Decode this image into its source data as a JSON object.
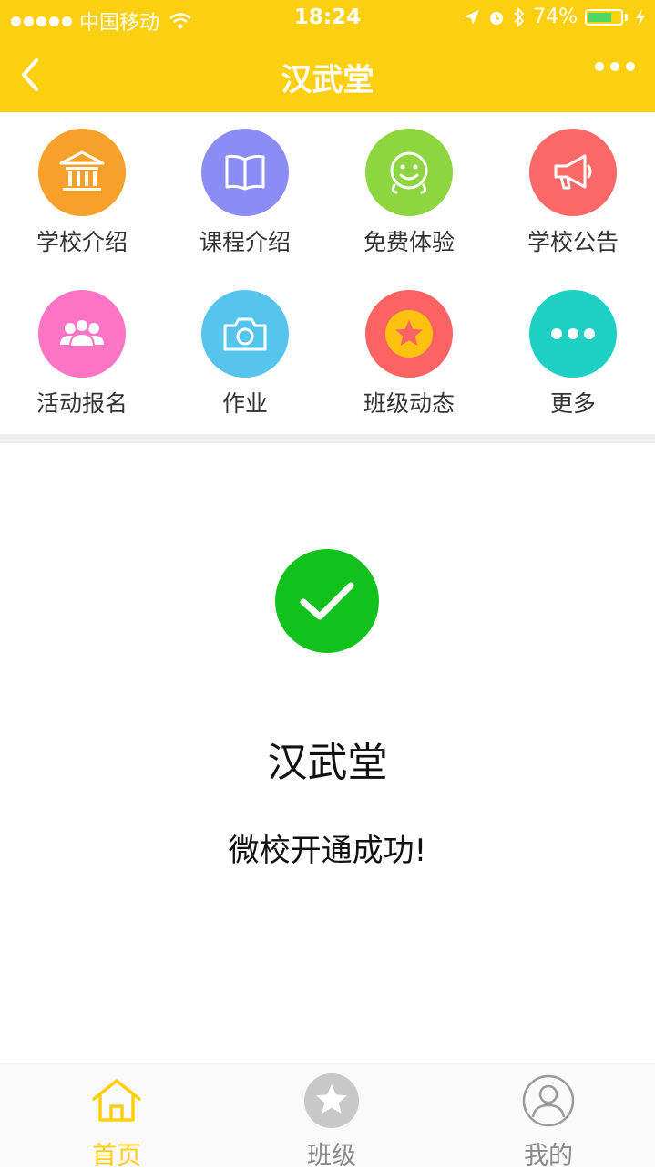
{
  "status_bar": {
    "carrier": "中国移动",
    "time": "18:24",
    "battery": "74%",
    "battery_level": 0.74
  },
  "nav": {
    "title": "汉武堂"
  },
  "grid": [
    {
      "label": "学校介绍",
      "icon": "school-building-icon",
      "color": "#f7a02c"
    },
    {
      "label": "课程介绍",
      "icon": "book-icon",
      "color": "#8c8cf5"
    },
    {
      "label": "免费体验",
      "icon": "smile-face-icon",
      "color": "#8ed640"
    },
    {
      "label": "学校公告",
      "icon": "megaphone-icon",
      "color": "#fb6868"
    },
    {
      "label": "活动报名",
      "icon": "group-people-icon",
      "color": "#fc75c5"
    },
    {
      "label": "作业",
      "icon": "camera-icon",
      "color": "#56c5ee"
    },
    {
      "label": "班级动态",
      "icon": "star-badge-icon",
      "color": "#fc6464"
    },
    {
      "label": "更多",
      "icon": "more-dots-icon",
      "color": "#1ed0c3"
    }
  ],
  "success": {
    "name": "汉武堂",
    "message": "微校开通成功!"
  },
  "tabs": [
    {
      "label": "首页",
      "icon": "home-icon",
      "active": true
    },
    {
      "label": "班级",
      "icon": "class-star-icon",
      "active": false
    },
    {
      "label": "我的",
      "icon": "profile-icon",
      "active": false
    }
  ],
  "colors": {
    "brand": "#fccf0f",
    "success": "#10c21b",
    "tab_active": "#fccf0f",
    "tab_inactive": "#8a8a8a"
  }
}
